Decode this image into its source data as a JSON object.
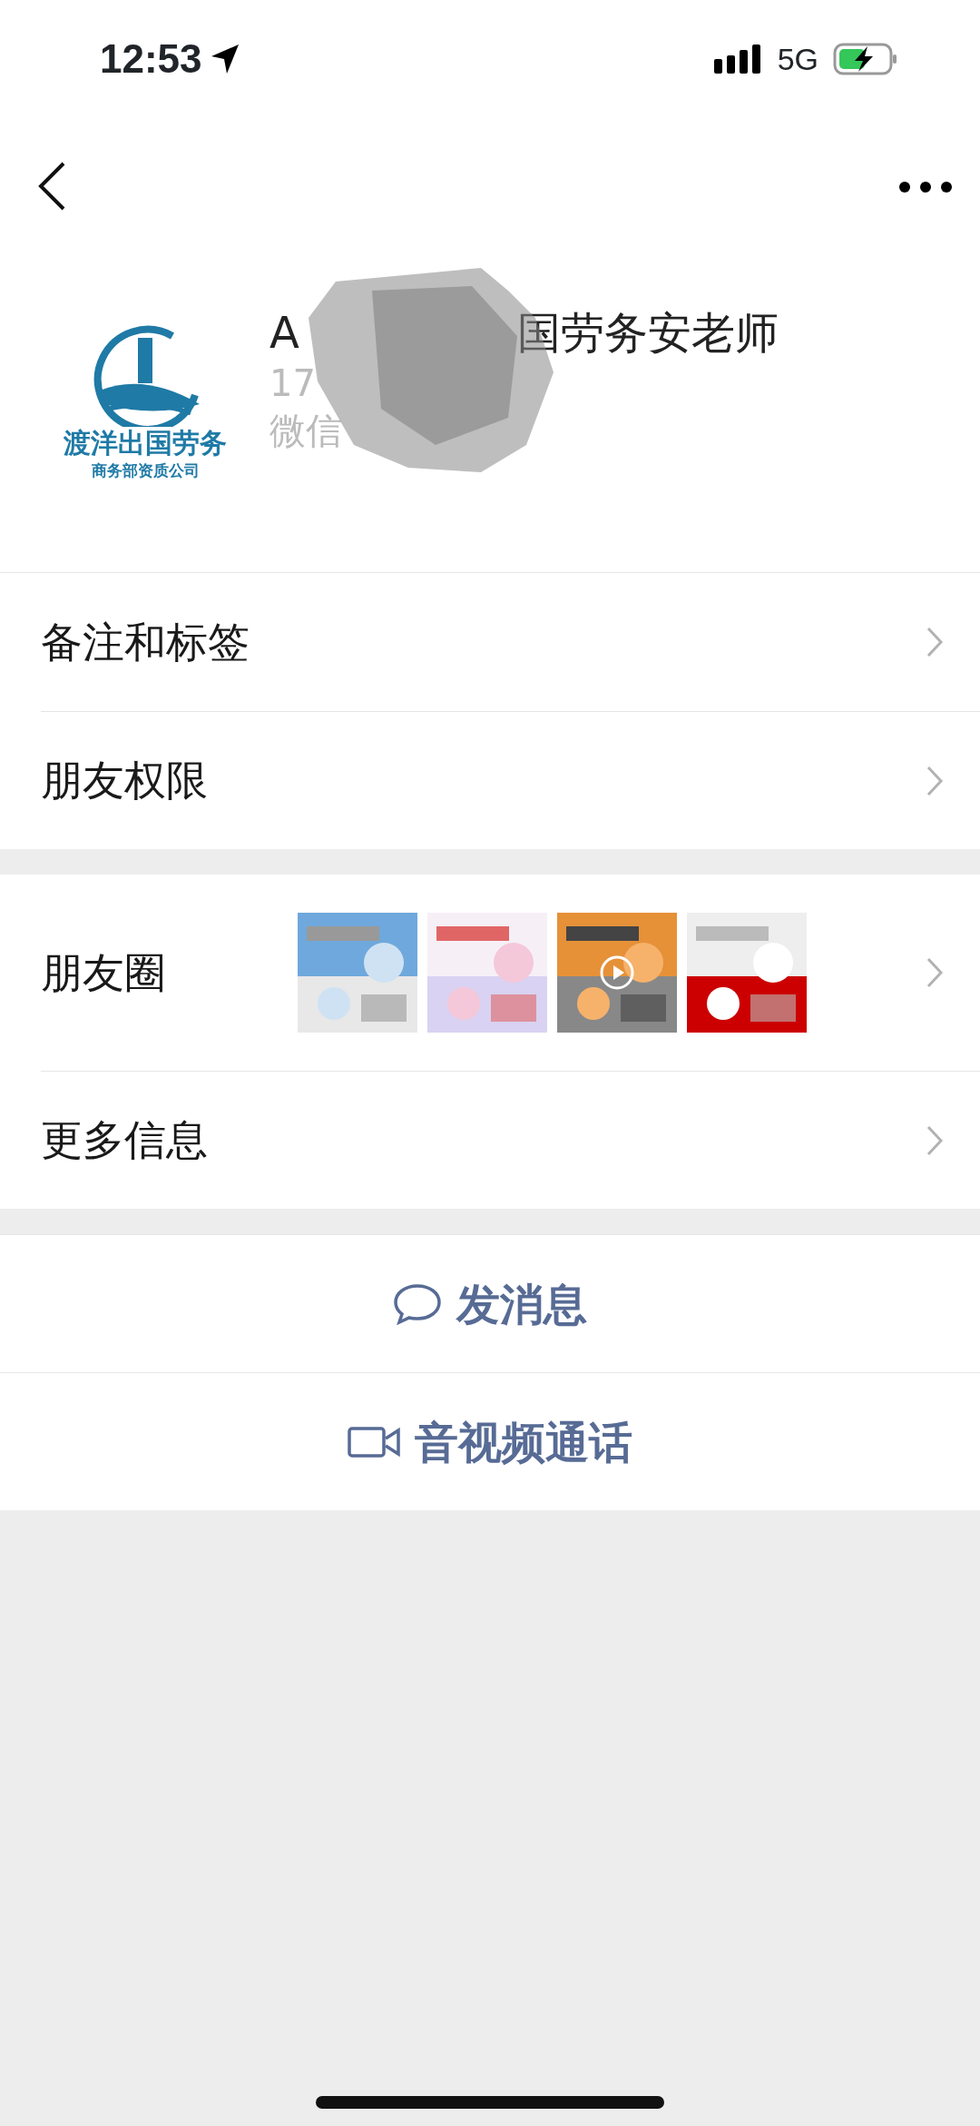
{
  "status_bar": {
    "time": "12:53",
    "network": "5G",
    "battery_charging": true
  },
  "profile": {
    "logo_title": "渡洋出国劳务",
    "logo_subtitle": "商务部资质公司",
    "name_start": "A",
    "name_end": "国劳务安老师",
    "phone_start": "17",
    "wechat_label": "微信"
  },
  "menu_groups": [
    [
      {
        "kind": "plain",
        "label": "备注和标签"
      },
      {
        "kind": "plain",
        "label": "朋友权限"
      }
    ],
    [
      {
        "kind": "moments",
        "label": "朋友圈",
        "thumbnails": [
          {
            "kind": "picture",
            "video": false
          },
          {
            "kind": "picture",
            "video": false
          },
          {
            "kind": "picture",
            "video": true
          },
          {
            "kind": "picture",
            "video": false
          }
        ]
      },
      {
        "kind": "plain",
        "label": "更多信息"
      }
    ]
  ],
  "actions": [
    {
      "kind": "message",
      "label": "发消息"
    },
    {
      "kind": "call",
      "label": "音视频通话"
    }
  ]
}
